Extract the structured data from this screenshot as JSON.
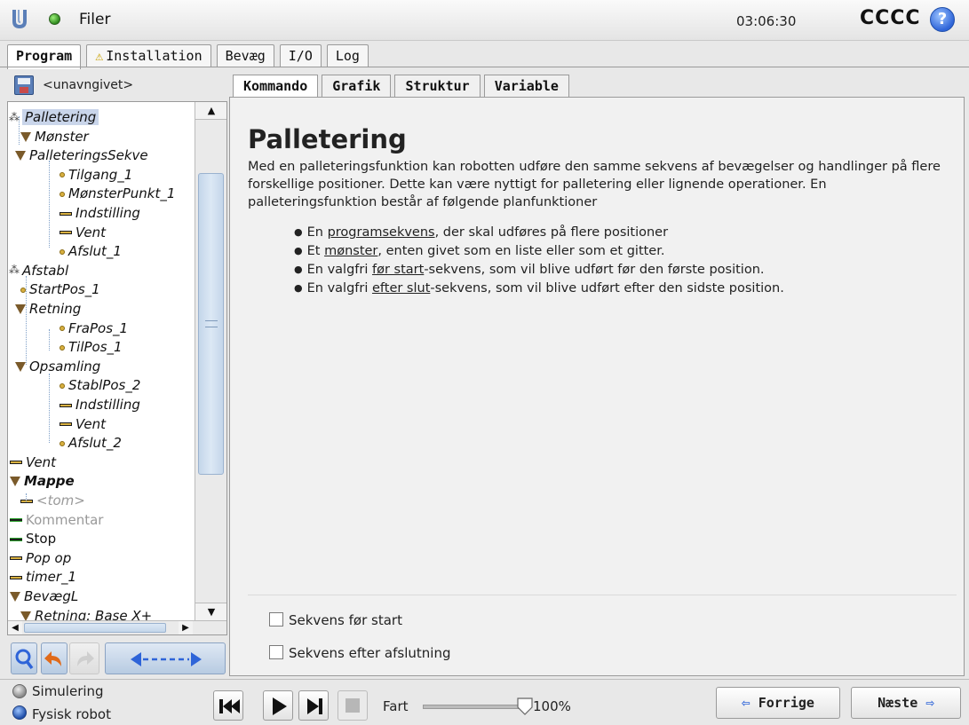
{
  "header": {
    "app_title": "Filer",
    "clock": "03:06:30",
    "robot_name": "CCCC",
    "help": "?"
  },
  "main_tabs": [
    "Program",
    "Installation",
    "Bevæg",
    "I/O",
    "Log"
  ],
  "file": {
    "name": "<unavngivet>"
  },
  "tree": [
    {
      "label": "Palletering",
      "icon": "pallet-icon"
    },
    {
      "label": "Mønster",
      "icon": "triangle-icon"
    },
    {
      "label": "PalleteringsSekve",
      "icon": "triangle-icon"
    },
    {
      "label": "Tilgang_1",
      "icon": "waypoint-icon"
    },
    {
      "label": "MønsterPunkt_1",
      "icon": "waypoint-icon"
    },
    {
      "label": "Indstilling",
      "icon": "bar-icon"
    },
    {
      "label": "Vent",
      "icon": "bar-icon"
    },
    {
      "label": "Afslut_1",
      "icon": "waypoint-icon"
    },
    {
      "label": "Afstabl",
      "icon": "pallet-icon"
    },
    {
      "label": "StartPos_1",
      "icon": "waypoint-icon"
    },
    {
      "label": "Retning",
      "icon": "triangle-icon"
    },
    {
      "label": "FraPos_1",
      "icon": "waypoint-icon"
    },
    {
      "label": "TilPos_1",
      "icon": "waypoint-icon"
    },
    {
      "label": "Opsamling",
      "icon": "triangle-icon"
    },
    {
      "label": "StablPos_2",
      "icon": "waypoint-icon"
    },
    {
      "label": "Indstilling",
      "icon": "bar-icon"
    },
    {
      "label": "Vent",
      "icon": "bar-icon"
    },
    {
      "label": "Afslut_2",
      "icon": "waypoint-icon"
    },
    {
      "label": "Vent",
      "icon": "bar-icon"
    },
    {
      "label": "Mappe",
      "icon": "triangle-icon"
    },
    {
      "label": "<tom>",
      "icon": "bar-icon"
    },
    {
      "label": "Kommentar",
      "icon": "green-bar-icon"
    },
    {
      "label": "Stop",
      "icon": "green-bar-icon"
    },
    {
      "label": "Pop op",
      "icon": "bar-icon"
    },
    {
      "label": "timer_1",
      "icon": "bar-icon"
    },
    {
      "label": "BevægL",
      "icon": "triangle-icon"
    },
    {
      "label": "Retning: Base X+",
      "icon": "triangle-icon"
    }
  ],
  "sub_tabs": [
    "Kommando",
    "Grafik",
    "Struktur",
    "Variable"
  ],
  "command": {
    "title": "Palletering",
    "description": "Med en palleteringsfunktion kan robotten udføre den samme sekvens af bevægelser og handlinger på flere forskellige positioner. Dette kan være nyttigt for palletering eller lignende operationer. En palleteringsfunktion består af følgende planfunktioner",
    "bullets": [
      {
        "pre": "En ",
        "link": "programsekvens",
        "post": ", der skal udføres på flere positioner"
      },
      {
        "pre": "Et ",
        "link": "mønster",
        "post": ", enten givet som en liste eller som et gitter."
      },
      {
        "pre": "En valgfri ",
        "link": "før start",
        "post": "-sekvens, som vil blive udført før den første position."
      },
      {
        "pre": "En valgfri ",
        "link": "efter slut",
        "post": "-sekvens, som vil blive udført efter den sidste position."
      }
    ],
    "options": {
      "before_start": {
        "label": "Sekvens før start",
        "checked": false
      },
      "after_end": {
        "label": "Sekvens efter afslutning",
        "checked": false
      }
    }
  },
  "footer": {
    "mode_simulation": "Simulering",
    "mode_real": "Fysisk robot",
    "speed_label": "Fart",
    "speed_value": "100%",
    "speed_fraction": 1.0,
    "prev": "Forrige",
    "next": "Næste"
  }
}
